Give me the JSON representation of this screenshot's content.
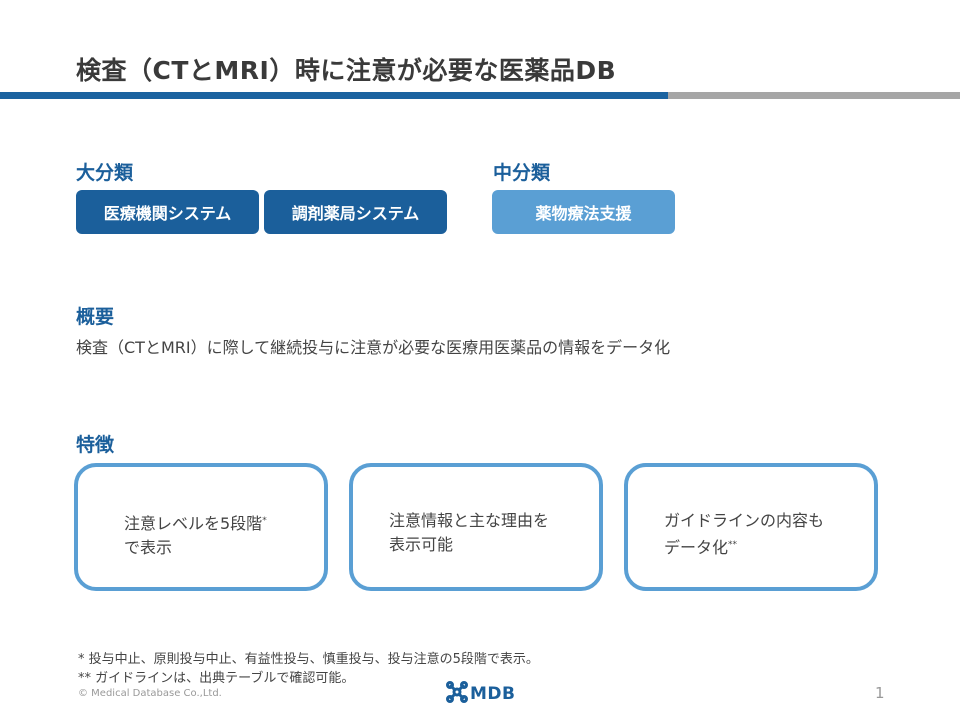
{
  "title": "検査（CTとMRI）時に注意が必要な医薬品DB",
  "brand": {
    "primary": "#1b5f9b",
    "light": "#5a9fd4",
    "gray": "#a6a6a6"
  },
  "major_category": {
    "heading": "大分類",
    "tags": [
      "医療機関システム",
      "調剤薬局システム"
    ]
  },
  "middle_category": {
    "heading": "中分類",
    "tags": [
      "薬物療法支援"
    ]
  },
  "overview": {
    "heading": "概要",
    "text": "検査（CTとMRI）に際して継続投与に注意が必要な医療用医薬品の情報をデータ化"
  },
  "features": {
    "heading": "特徴",
    "cards": [
      {
        "line1": "注意レベルを5段階",
        "mark": "*",
        "line2": "で表示"
      },
      {
        "line1": "注意情報と主な理由を",
        "mark": "",
        "line2": "表示可能"
      },
      {
        "line1": "ガイドラインの内容も",
        "mark": "**",
        "line2": "データ化"
      }
    ]
  },
  "footnotes": [
    "* 投与中止、原則投与中止、有益性投与、慎重投与、投与注意の5段階で表示。",
    "** ガイドラインは、出典テーブルで確認可能。"
  ],
  "footer": {
    "copyright": "© Medical Database Co.,Ltd.",
    "logo_text": "MDB",
    "logo_icon": "mdb-cross-logo",
    "page_number": "1"
  }
}
